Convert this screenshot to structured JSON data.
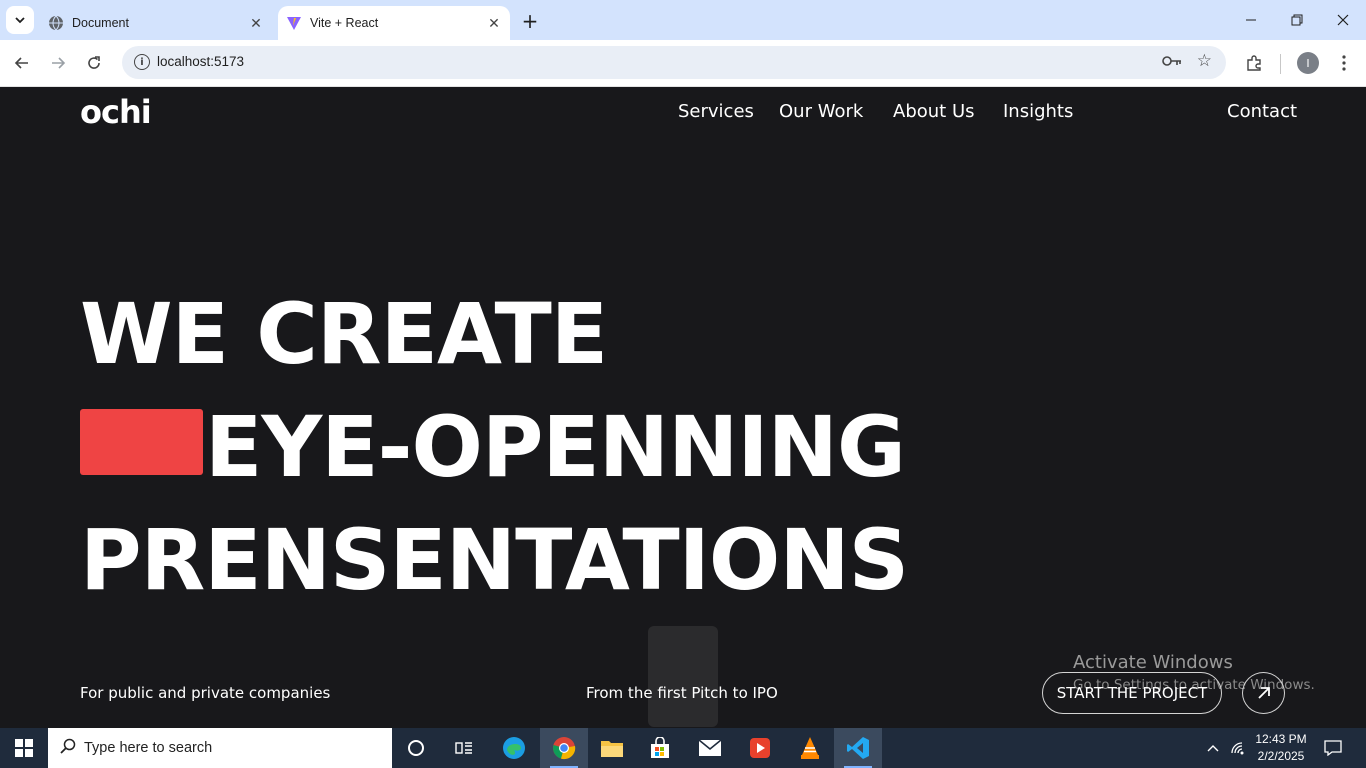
{
  "browser": {
    "tabs": [
      {
        "title": "Document",
        "active": false
      },
      {
        "title": "Vite + React",
        "active": true
      }
    ],
    "url": "localhost:5173",
    "profile_initial": "I"
  },
  "site": {
    "logo": "ochi",
    "nav": [
      "Services",
      "Our Work",
      "About Us",
      "Insights"
    ],
    "contact": "Contact",
    "hero_lines": [
      "WE CREATE",
      "EYE-OPENNING",
      "PRENSENTATIONS"
    ],
    "accent_color": "#ef4444",
    "footer_left": "For public and private companies",
    "footer_center": "From the first Pitch to IPO",
    "cta_label": "START THE PROJECT"
  },
  "watermark": {
    "line1": "Activate Windows",
    "line2": "Go to Settings to activate Windows."
  },
  "taskbar": {
    "search_placeholder": "Type here to search",
    "time": "12:43 PM",
    "date": "2/2/2025",
    "apps": [
      "cortana-icon",
      "task-view-icon",
      "edge-icon",
      "chrome-icon",
      "file-explorer-icon",
      "store-icon",
      "mail-icon",
      "media-player-icon",
      "vlc-icon",
      "vscode-icon"
    ]
  }
}
